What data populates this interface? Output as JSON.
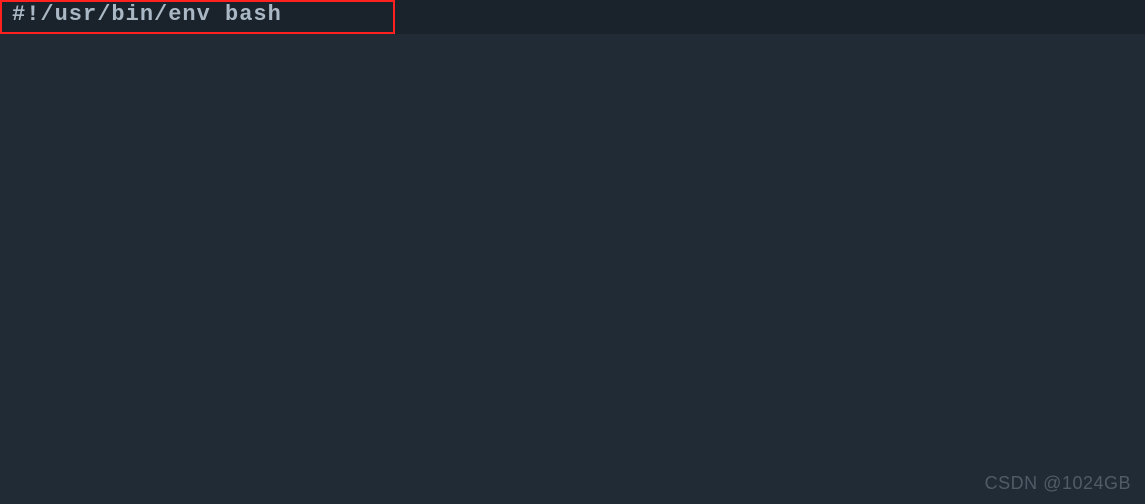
{
  "editor": {
    "shebang_line": "#!/usr/bin/env bash"
  },
  "watermark": {
    "text": "CSDN @1024GB"
  }
}
